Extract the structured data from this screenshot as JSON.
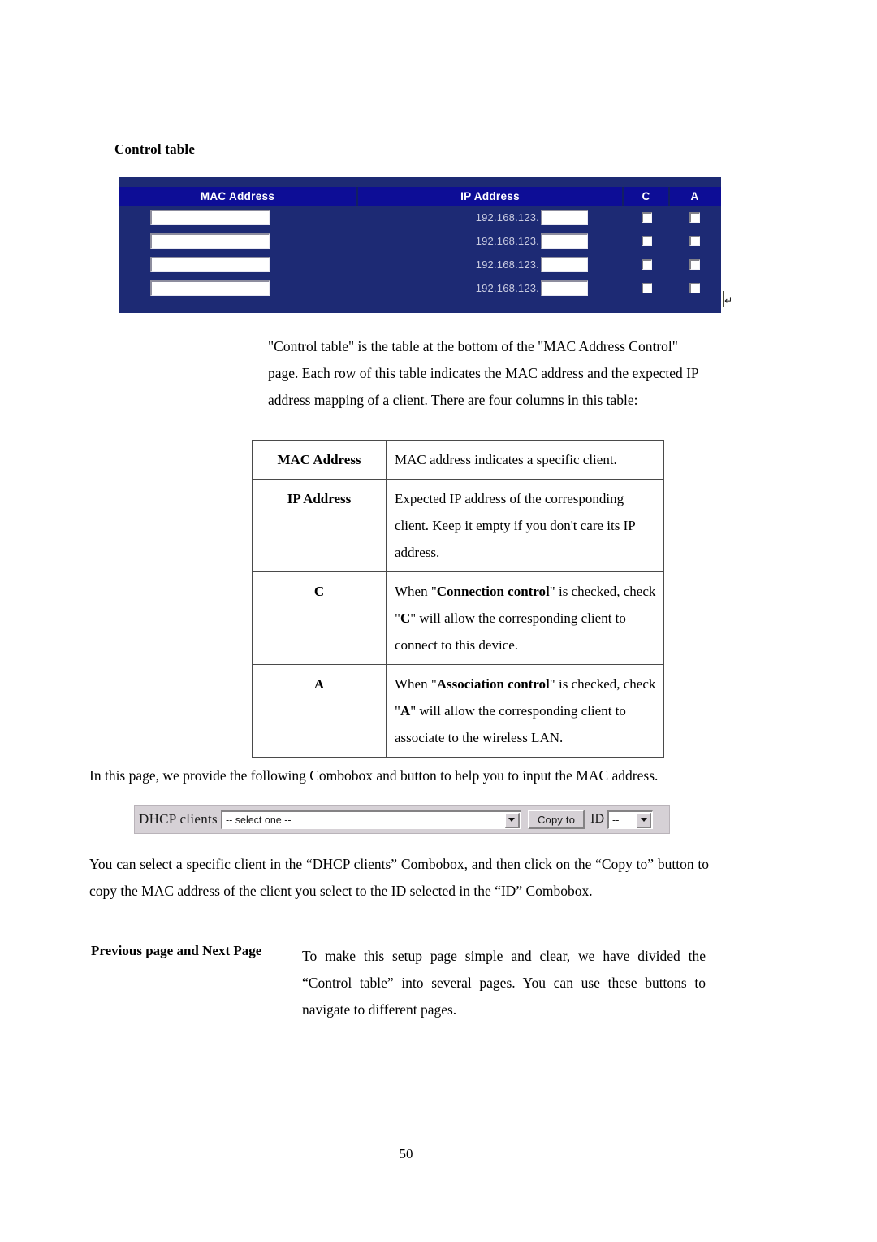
{
  "document": {
    "heading": "Control table",
    "page_number": "50"
  },
  "router_table": {
    "columns": {
      "mac": "MAC Address",
      "ip": "IP Address",
      "c": "C",
      "a": "A"
    },
    "ip_prefix": "192.168.123.",
    "rows": [
      {
        "mac_value": "",
        "ip_value": "",
        "c_checked": false,
        "a_checked": false
      },
      {
        "mac_value": "",
        "ip_value": "",
        "c_checked": false,
        "a_checked": false
      },
      {
        "mac_value": "",
        "ip_value": "",
        "c_checked": false,
        "a_checked": false
      },
      {
        "mac_value": "",
        "ip_value": "",
        "c_checked": false,
        "a_checked": false
      }
    ],
    "colors": {
      "panel_background": "#1d2a74",
      "header_background": "#0d0d96",
      "header_text": "#ffffff",
      "ip_prefix_text": "#c9cbe0",
      "input_background": "#ffffff"
    }
  },
  "paragraphs": {
    "intro": "\"Control table\" is the table at the bottom of the \"MAC Address Control\" page. Each row of this table indicates the MAC address and the expected IP address mapping of a client. There are four columns in this table:",
    "combobox_intro": "In this page, we provide the following Combobox and button to help you to input the MAC address.",
    "select_client": "You can select a specific client in the “DHCP clients” Combobox, and then click on the “Copy to” button to copy the MAC address of the client you select to the ID selected in the “ID” Combobox."
  },
  "definition_table": {
    "rows": [
      {
        "term": "MAC Address",
        "description": "MAC address indicates a specific client."
      },
      {
        "term": "IP Address",
        "description": "Expected IP address of the corresponding client. Keep it empty if you don't care its IP address."
      },
      {
        "term": "C",
        "desc_part1": "When \"",
        "desc_bold1": "Connection control",
        "desc_part2": "\" is checked, check \"",
        "desc_bold2": "C",
        "desc_part3": "\" will allow the corresponding client to connect to this device."
      },
      {
        "term": "A",
        "desc_part1": "When \"",
        "desc_bold1": "Association control",
        "desc_part2": "\" is checked, check \"",
        "desc_bold2": "A",
        "desc_part3": "\" will allow the corresponding client to associate to the wireless LAN."
      }
    ]
  },
  "dhcp_widget": {
    "label": "DHCP clients",
    "clients_selected": "-- select one --",
    "copy_button": "Copy to",
    "id_label": "ID",
    "id_selected": "--"
  },
  "prev_next_section": {
    "term": "Previous page and Next Page",
    "description": "To make this setup page simple and clear, we have divided the “Control table” into several pages. You can use these buttons to navigate to different pages."
  }
}
